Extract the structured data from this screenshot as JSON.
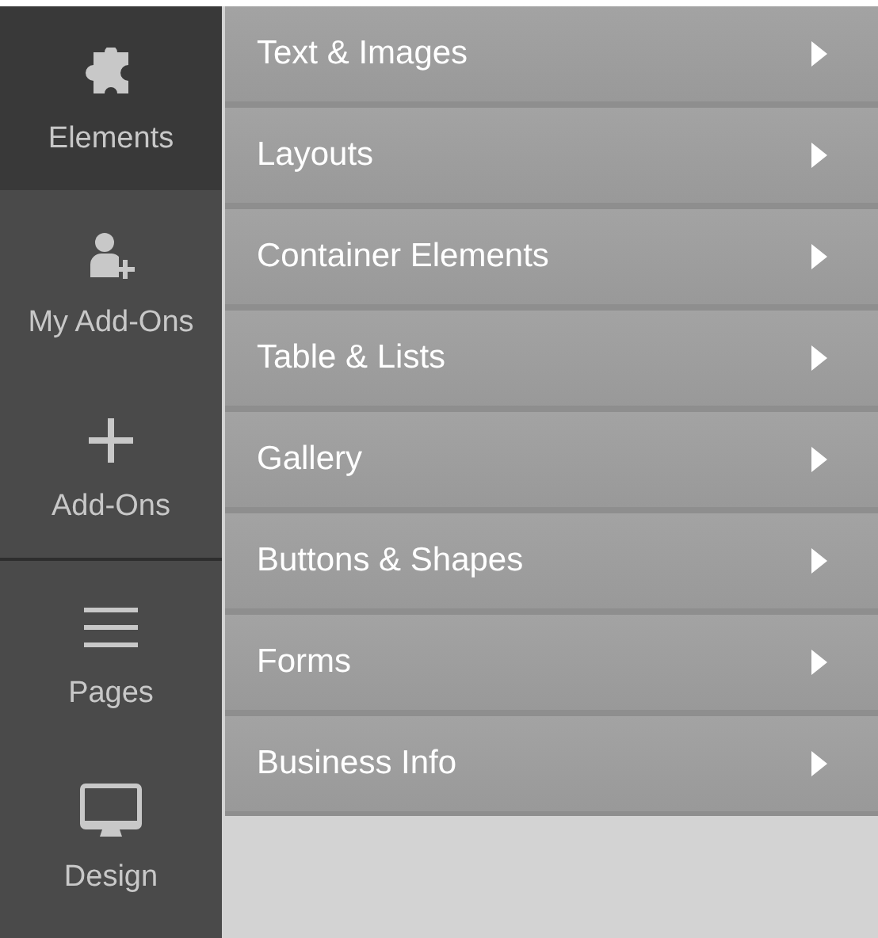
{
  "sidebar": {
    "sections": [
      {
        "items": [
          {
            "label": "Elements",
            "kind": "puzzle",
            "selected": true
          },
          {
            "label": "My Add-Ons",
            "kind": "user-plus",
            "selected": false
          },
          {
            "label": "Add-Ons",
            "kind": "plus",
            "selected": false
          }
        ]
      },
      {
        "items": [
          {
            "label": "Pages",
            "kind": "lines",
            "selected": false
          },
          {
            "label": "Design",
            "kind": "monitor",
            "selected": false
          }
        ]
      }
    ]
  },
  "menu": {
    "items": [
      {
        "label": "Text & Images"
      },
      {
        "label": "Layouts"
      },
      {
        "label": "Container Elements"
      },
      {
        "label": "Table & Lists"
      },
      {
        "label": "Gallery"
      },
      {
        "label": "Buttons & Shapes"
      },
      {
        "label": "Forms"
      },
      {
        "label": "Business Info"
      }
    ]
  }
}
